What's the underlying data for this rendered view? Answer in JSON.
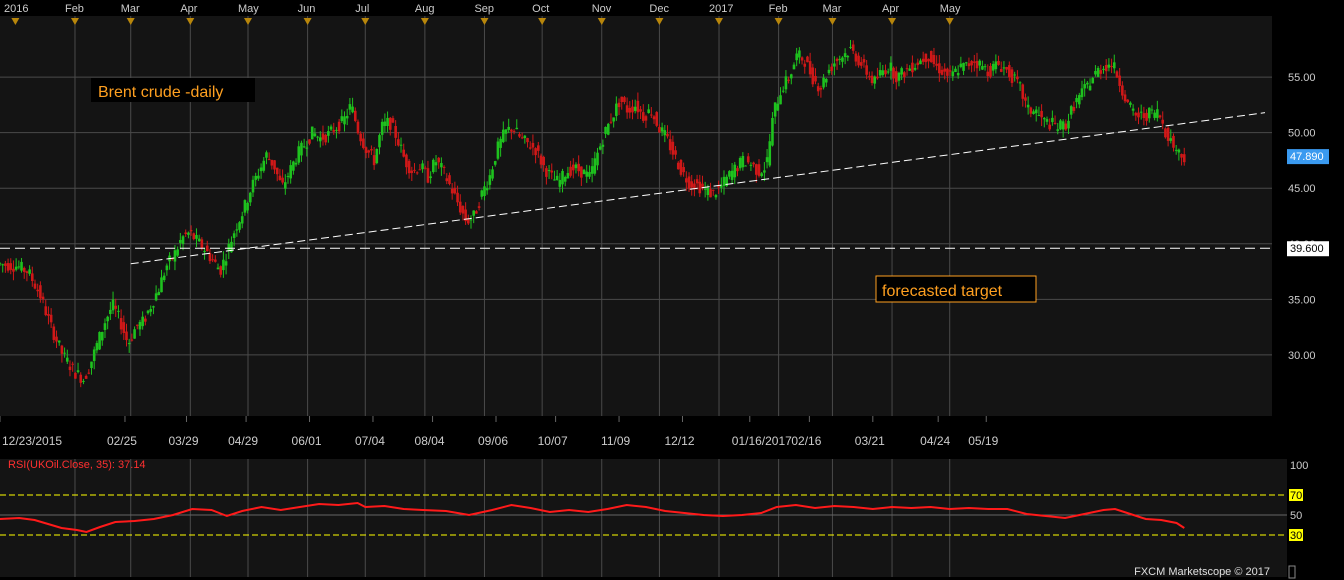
{
  "chart_data": [
    {
      "type": "candlestick",
      "title": "Brent crude -daily",
      "top_axis": {
        "year_start": "2016",
        "months": [
          "Feb",
          "Mar",
          "Apr",
          "May",
          "Jun",
          "Jul",
          "Aug",
          "Sep",
          "Oct",
          "Nov",
          "Dec",
          "2017",
          "Feb",
          "Mar",
          "Apr",
          "May"
        ]
      },
      "x_tick_labels": [
        "12/23/2015",
        "02/25",
        "03/29",
        "04/29",
        "06/01",
        "07/04",
        "08/04",
        "09/06",
        "10/07",
        "11/09",
        "12/12",
        "01/16/2017",
        "02/16",
        "03/21",
        "04/24",
        "05/19"
      ],
      "y_ticks": [
        30.0,
        35.0,
        40.0,
        45.0,
        50.0,
        55.0
      ],
      "y_tick_labels": [
        "30.00",
        "35.00",
        "40.00",
        "45.00",
        "50.00",
        "55.00"
      ],
      "ylim": [
        24.5,
        60.5
      ],
      "grid": true,
      "price_path": [
        [
          0,
          38.2
        ],
        [
          10,
          38.0
        ],
        [
          16,
          37.5
        ],
        [
          22,
          35.5
        ],
        [
          28,
          32.5
        ],
        [
          34,
          30.0
        ],
        [
          40,
          28.5
        ],
        [
          45,
          27.8
        ],
        [
          48,
          29.0
        ],
        [
          52,
          31.0
        ],
        [
          56,
          33.0
        ],
        [
          60,
          34.5
        ],
        [
          64,
          33.0
        ],
        [
          68,
          31.0
        ],
        [
          72,
          32.5
        ],
        [
          76,
          33.0
        ],
        [
          80,
          34.5
        ],
        [
          84,
          36.0
        ],
        [
          88,
          38.0
        ],
        [
          92,
          39.0
        ],
        [
          96,
          40.5
        ],
        [
          100,
          41.0
        ],
        [
          104,
          40.2
        ],
        [
          108,
          39.5
        ],
        [
          112,
          38.5
        ],
        [
          116,
          37.6
        ],
        [
          120,
          39.5
        ],
        [
          124,
          41.5
        ],
        [
          128,
          43.0
        ],
        [
          132,
          45.0
        ],
        [
          136,
          46.5
        ],
        [
          140,
          48.0
        ],
        [
          144,
          47.0
        ],
        [
          148,
          45.0
        ],
        [
          152,
          46.5
        ],
        [
          156,
          48.0
        ],
        [
          160,
          49.0
        ],
        [
          164,
          50.0
        ],
        [
          168,
          49.5
        ],
        [
          172,
          49.8
        ],
        [
          176,
          50.5
        ],
        [
          180,
          51.0
        ],
        [
          184,
          52.5
        ],
        [
          188,
          50.0
        ],
        [
          192,
          48.5
        ],
        [
          196,
          47.5
        ],
        [
          200,
          50.5
        ],
        [
          204,
          51.0
        ],
        [
          208,
          49.5
        ],
        [
          212,
          47.5
        ],
        [
          216,
          46.5
        ],
        [
          220,
          47.0
        ],
        [
          224,
          46.0
        ],
        [
          228,
          47.5
        ],
        [
          232,
          46.5
        ],
        [
          236,
          45.0
        ],
        [
          240,
          43.5
        ],
        [
          244,
          42.0
        ],
        [
          248,
          42.5
        ],
        [
          252,
          44.5
        ],
        [
          256,
          46.0
        ],
        [
          260,
          48.5
        ],
        [
          264,
          50.0
        ],
        [
          268,
          50.5
        ],
        [
          272,
          49.5
        ],
        [
          276,
          49.0
        ],
        [
          280,
          48.5
        ],
        [
          284,
          47.0
        ],
        [
          288,
          46.0
        ],
        [
          292,
          45.5
        ],
        [
          296,
          46.5
        ],
        [
          300,
          46.8
        ],
        [
          304,
          46.5
        ],
        [
          308,
          46.0
        ],
        [
          312,
          48.0
        ],
        [
          316,
          50.0
        ],
        [
          320,
          51.5
        ],
        [
          324,
          53.0
        ],
        [
          328,
          52.0
        ],
        [
          332,
          52.5
        ],
        [
          336,
          51.5
        ],
        [
          340,
          52.0
        ],
        [
          344,
          50.5
        ],
        [
          348,
          49.5
        ],
        [
          352,
          48.0
        ],
        [
          356,
          46.5
        ],
        [
          360,
          45.5
        ],
        [
          364,
          45.3
        ],
        [
          368,
          44.8
        ],
        [
          372,
          44.5
        ],
        [
          376,
          45.0
        ],
        [
          380,
          46.0
        ],
        [
          384,
          46.8
        ],
        [
          388,
          47.5
        ],
        [
          392,
          47.2
        ],
        [
          396,
          46.5
        ],
        [
          400,
          47.0
        ],
        [
          404,
          52.0
        ],
        [
          408,
          54.0
        ],
        [
          412,
          55.0
        ],
        [
          416,
          57.0
        ],
        [
          420,
          56.5
        ],
        [
          424,
          55.0
        ],
        [
          428,
          54.0
        ],
        [
          432,
          55.5
        ],
        [
          436,
          56.5
        ],
        [
          440,
          57.0
        ],
        [
          444,
          57.5
        ],
        [
          448,
          56.5
        ],
        [
          452,
          55.5
        ],
        [
          456,
          54.5
        ],
        [
          460,
          55.5
        ],
        [
          464,
          56.0
        ],
        [
          468,
          55.0
        ],
        [
          472,
          55.5
        ],
        [
          476,
          56.0
        ],
        [
          480,
          56.5
        ],
        [
          484,
          57.0
        ],
        [
          488,
          56.0
        ],
        [
          492,
          55.5
        ],
        [
          496,
          55.0
        ],
        [
          500,
          55.8
        ],
        [
          504,
          56.0
        ],
        [
          508,
          56.5
        ],
        [
          512,
          56.0
        ],
        [
          516,
          55.5
        ],
        [
          520,
          56.2
        ],
        [
          524,
          55.8
        ],
        [
          528,
          55.0
        ],
        [
          532,
          54.0
        ],
        [
          536,
          52.0
        ],
        [
          540,
          52.0
        ],
        [
          544,
          51.0
        ],
        [
          548,
          50.8
        ],
        [
          552,
          50.5
        ],
        [
          556,
          50.8
        ],
        [
          560,
          52.5
        ],
        [
          564,
          53.5
        ],
        [
          568,
          54.5
        ],
        [
          572,
          55.5
        ],
        [
          576,
          56.0
        ],
        [
          580,
          56.2
        ],
        [
          584,
          54.5
        ],
        [
          588,
          52.5
        ],
        [
          592,
          51.5
        ],
        [
          596,
          51.5
        ],
        [
          600,
          51.8
        ],
        [
          604,
          51.8
        ],
        [
          608,
          50.0
        ],
        [
          612,
          48.8
        ],
        [
          616,
          47.9
        ]
      ],
      "trendline": {
        "from": [
          68,
          38.2
        ],
        "to": [
          658,
          51.8
        ],
        "style": "dashed",
        "color": "#ffffff"
      },
      "target_line": {
        "value": 39.6,
        "label": "39.600",
        "style": "dashed",
        "color": "#ffffff"
      },
      "last_price": {
        "value": 47.89,
        "label": "47.890"
      },
      "annotations": [
        {
          "text": "forecasted target"
        }
      ]
    },
    {
      "type": "line",
      "name": "RSI(UKOil.Close, 35): 37.14",
      "y_ticks": [
        30,
        50,
        70,
        100
      ],
      "y_tick_labels": [
        "30",
        "50",
        "70",
        "100"
      ],
      "ylim": [
        0,
        100
      ],
      "reference_levels": [
        30,
        70
      ],
      "values": [
        [
          0,
          46
        ],
        [
          10,
          47
        ],
        [
          18,
          45
        ],
        [
          25,
          41
        ],
        [
          32,
          37
        ],
        [
          40,
          35
        ],
        [
          45,
          33
        ],
        [
          52,
          38
        ],
        [
          60,
          43
        ],
        [
          70,
          44
        ],
        [
          80,
          46
        ],
        [
          90,
          50
        ],
        [
          100,
          56
        ],
        [
          110,
          55
        ],
        [
          118,
          49
        ],
        [
          126,
          54
        ],
        [
          136,
          58
        ],
        [
          146,
          55
        ],
        [
          156,
          58
        ],
        [
          166,
          61
        ],
        [
          176,
          60
        ],
        [
          186,
          62
        ],
        [
          190,
          58
        ],
        [
          200,
          59
        ],
        [
          210,
          56
        ],
        [
          220,
          55
        ],
        [
          232,
          54
        ],
        [
          244,
          50
        ],
        [
          256,
          55
        ],
        [
          266,
          60
        ],
        [
          276,
          57
        ],
        [
          286,
          53
        ],
        [
          296,
          55
        ],
        [
          306,
          53
        ],
        [
          316,
          56
        ],
        [
          326,
          60
        ],
        [
          336,
          58
        ],
        [
          346,
          54
        ],
        [
          356,
          52
        ],
        [
          366,
          50
        ],
        [
          376,
          49
        ],
        [
          386,
          50
        ],
        [
          396,
          52
        ],
        [
          404,
          58
        ],
        [
          414,
          60
        ],
        [
          424,
          57
        ],
        [
          434,
          59
        ],
        [
          444,
          58
        ],
        [
          454,
          56
        ],
        [
          464,
          58
        ],
        [
          474,
          57
        ],
        [
          484,
          58
        ],
        [
          494,
          56
        ],
        [
          504,
          57
        ],
        [
          514,
          56
        ],
        [
          524,
          56
        ],
        [
          534,
          51
        ],
        [
          544,
          49
        ],
        [
          554,
          47
        ],
        [
          564,
          51
        ],
        [
          574,
          55
        ],
        [
          580,
          56
        ],
        [
          588,
          51
        ],
        [
          596,
          46
        ],
        [
          604,
          45
        ],
        [
          612,
          42
        ],
        [
          616,
          37
        ]
      ]
    }
  ],
  "colors": {
    "up_candle": "#1ec21e",
    "down_candle": "#d01818",
    "rsi_line": "#ff1a1a",
    "rsi_levels": "#ffff00",
    "grid": "#4a4a4a",
    "plot_bg": "#141414",
    "axis_text": "#cccccc",
    "title_box_text": "#ffa020",
    "last_price_bg": "#3a9af0"
  },
  "footer": "FXCM Marketscope © 2017"
}
